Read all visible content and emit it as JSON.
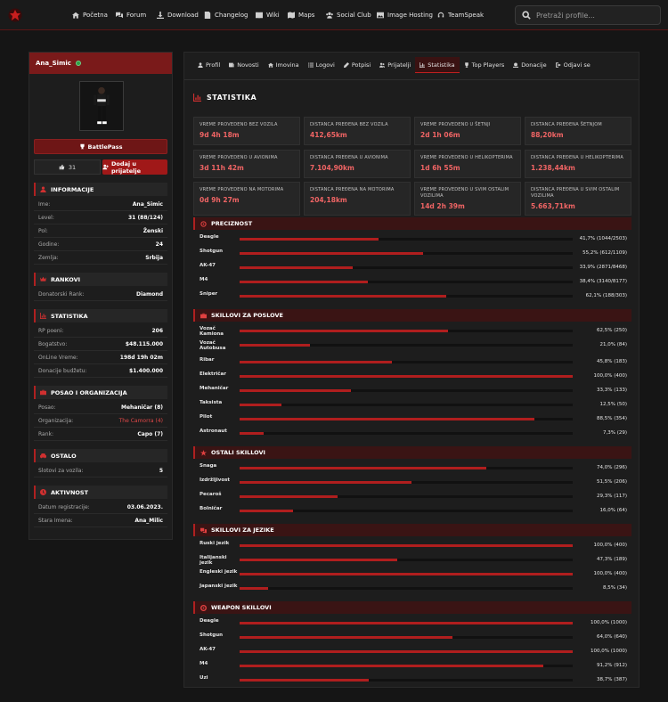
{
  "nav": {
    "items": [
      "Početna",
      "Forum",
      "Download",
      "Changelog",
      "Wiki",
      "Maps",
      "Social Club",
      "Image Hosting",
      "TeamSpeak"
    ],
    "search_placeholder": "Pretraži profile..."
  },
  "profile": {
    "username": "Ana_Simic",
    "battlepass_label": "BattlePass",
    "likes": "31",
    "add_friend_label": "Dodaj u prijatelje",
    "sections": [
      {
        "title": "INFORMACIJE",
        "icon": "user-icon",
        "rows": [
          {
            "k": "Ime:",
            "v": "Ana_Simic"
          },
          {
            "k": "Level:",
            "v": "31 (88/124)"
          },
          {
            "k": "Pol:",
            "v": "Ženski"
          },
          {
            "k": "Godine:",
            "v": "24"
          },
          {
            "k": "Zemlja:",
            "v": "Srbija"
          }
        ]
      },
      {
        "title": "RANKOVI",
        "icon": "crown-icon",
        "rows": [
          {
            "k": "Donatorski Rank:",
            "v": "Diamond"
          }
        ]
      },
      {
        "title": "STATISTIKA",
        "icon": "chart-icon",
        "rows": [
          {
            "k": "RP poeni:",
            "v": "206"
          },
          {
            "k": "Bogatstvo:",
            "v": "$48.115.000"
          },
          {
            "k": "OnLine Vreme:",
            "v": "198d 19h 02m"
          },
          {
            "k": "Donacije budžetu:",
            "v": "$1.400.000"
          }
        ]
      },
      {
        "title": "POSAO I ORGANIZACIJA",
        "icon": "briefcase-icon",
        "rows": [
          {
            "k": "Posao:",
            "v": "Mehaničar (8)"
          },
          {
            "k": "Organizacija:",
            "v": "The Camorra (4)",
            "red": true
          },
          {
            "k": "Rank:",
            "v": "Capo (7)"
          }
        ]
      },
      {
        "title": "OSTALO",
        "icon": "car-icon",
        "rows": [
          {
            "k": "Slotovi za vozila:",
            "v": "5"
          }
        ]
      },
      {
        "title": "AKTIVNOST",
        "icon": "clock-icon",
        "rows": [
          {
            "k": "Datum registracije:",
            "v": "03.06.2023."
          },
          {
            "k": "Stara Imena:",
            "v": "Ana_Milic"
          }
        ]
      }
    ]
  },
  "tabs": [
    {
      "label": "Profil",
      "icon": "user-icon"
    },
    {
      "label": "Novosti",
      "icon": "news-icon"
    },
    {
      "label": "Imovina",
      "icon": "home-icon"
    },
    {
      "label": "Logovi",
      "icon": "list-icon"
    },
    {
      "label": "Potpisi",
      "icon": "pen-icon"
    },
    {
      "label": "Prijatelji",
      "icon": "users-icon"
    },
    {
      "label": "Statistika",
      "icon": "chart-icon",
      "active": true
    },
    {
      "label": "Top Players",
      "icon": "trophy-icon"
    },
    {
      "label": "Donacije",
      "icon": "donate-icon"
    },
    {
      "label": "Odjavi se",
      "icon": "logout-icon"
    }
  ],
  "statistika": {
    "title": "STATISTIKA",
    "tiles": [
      {
        "label": "VREME PROVEDENO BEZ VOZILA",
        "value": "9d 4h 18m"
      },
      {
        "label": "DISTANCA PREĐENA BEZ VOZILA",
        "value": "412,65km"
      },
      {
        "label": "VREME PROVEDENO U ŠETNJI",
        "value": "2d 1h 06m"
      },
      {
        "label": "DISTANCA PREĐENA ŠETNJOM",
        "value": "88,20km"
      },
      {
        "label": "VREME PROVEDENO U AVIONIMA",
        "value": "3d 11h 42m"
      },
      {
        "label": "DISTANCA PREĐENA U AVIONIMA",
        "value": "7.104,90km"
      },
      {
        "label": "VREME PROVEDENO U HELIKOPTERIMA",
        "value": "1d 6h 55m"
      },
      {
        "label": "DISTANCA PREĐENA U HELIKOPTERIMA",
        "value": "1.238,44km"
      },
      {
        "label": "VREME PROVEDENO NA MOTORIMA",
        "value": "0d 9h 27m"
      },
      {
        "label": "DISTANCA PREĐENA NA MOTORIMA",
        "value": "204,18km"
      },
      {
        "label": "VREME PROVEDENO U SVIM OSTALIM VOZILIMA",
        "value": "14d 2h 39m"
      },
      {
        "label": "DISTANCA PREĐENA U SVIM OSTALIM VOZILIMA",
        "value": "5.663,71km"
      }
    ],
    "sections": [
      {
        "title": "PRECIZNOST",
        "icon": "crosshair-icon",
        "rows": [
          {
            "label": "Deagle",
            "pct": 41.7,
            "text": "41,7% (1044/2503)"
          },
          {
            "label": "Shotgun",
            "pct": 55.2,
            "text": "55,2% (612/1109)"
          },
          {
            "label": "AK-47",
            "pct": 33.9,
            "text": "33,9% (2871/8468)"
          },
          {
            "label": "M4",
            "pct": 38.4,
            "text": "38,4% (3140/8177)"
          },
          {
            "label": "Sniper",
            "pct": 62.1,
            "text": "62,1% (188/303)"
          }
        ]
      },
      {
        "title": "SKILLOVI ZA POSLOVE",
        "icon": "briefcase-icon",
        "rows": [
          {
            "label": "Vozač Kamiona",
            "pct": 62.5,
            "text": "62,5% (250)"
          },
          {
            "label": "Vozač Autobusa",
            "pct": 21.0,
            "text": "21,0% (84)"
          },
          {
            "label": "Ribar",
            "pct": 45.8,
            "text": "45,8% (183)"
          },
          {
            "label": "Električar",
            "pct": 100,
            "text": "100,0% (400)"
          },
          {
            "label": "Mehaničar",
            "pct": 33.3,
            "text": "33,3% (133)"
          },
          {
            "label": "Taksista",
            "pct": 12.5,
            "text": "12,5% (50)"
          },
          {
            "label": "Pilot",
            "pct": 88.5,
            "text": "88,5% (354)"
          },
          {
            "label": "Astronaut",
            "pct": 7.3,
            "text": "7,3% (29)"
          }
        ]
      },
      {
        "title": "OSTALI SKILLOVI",
        "icon": "star-icon",
        "rows": [
          {
            "label": "Snaga",
            "pct": 74.0,
            "text": "74,0% (296)"
          },
          {
            "label": "Izdržljivost",
            "pct": 51.5,
            "text": "51,5% (206)"
          },
          {
            "label": "Pecaroš",
            "pct": 29.3,
            "text": "29,3% (117)"
          },
          {
            "label": "Bolničar",
            "pct": 16.0,
            "text": "16,0% (64)"
          }
        ]
      },
      {
        "title": "SKILLOVI ZA JEZIKE",
        "icon": "language-icon",
        "rows": [
          {
            "label": "Ruski jezik",
            "pct": 100,
            "text": "100,0% (400)"
          },
          {
            "label": "Italijanski jezik",
            "pct": 47.3,
            "text": "47,3% (189)"
          },
          {
            "label": "Engleski jezik",
            "pct": 100,
            "text": "100,0% (400)"
          },
          {
            "label": "Japanski jezik",
            "pct": 8.5,
            "text": "8,5% (34)"
          }
        ]
      },
      {
        "title": "WEAPON SKILLOVI",
        "icon": "target-icon",
        "rows": [
          {
            "label": "Deagle",
            "pct": 100,
            "text": "100,0% (1000)"
          },
          {
            "label": "Shotgun",
            "pct": 64.0,
            "text": "64,0% (640)"
          },
          {
            "label": "AK-47",
            "pct": 100,
            "text": "100,0% (1000)"
          },
          {
            "label": "M4",
            "pct": 91.2,
            "text": "91,2% (912)"
          },
          {
            "label": "Uzi",
            "pct": 38.7,
            "text": "38,7% (387)"
          }
        ]
      }
    ]
  }
}
